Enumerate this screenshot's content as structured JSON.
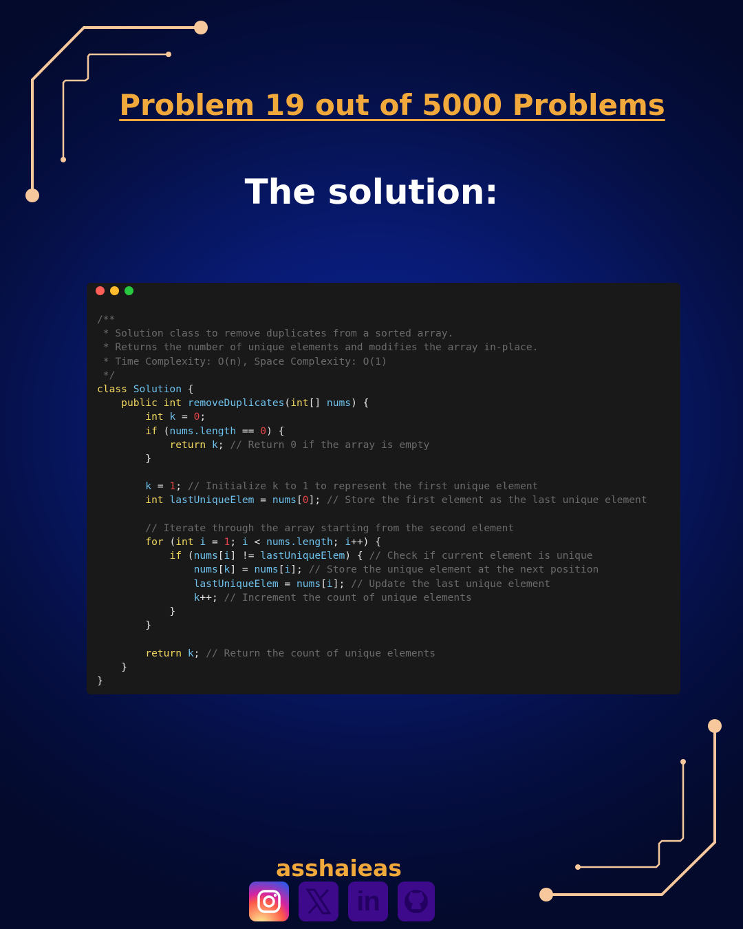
{
  "header": {
    "title": "Problem 19 out of 5000 Problems",
    "subtitle": "The solution:"
  },
  "colors": {
    "accent": "#f2a93b",
    "circuit": "#f7c89c",
    "code_bg": "#191919",
    "keyword": "#f0d860",
    "identifier": "#6ec1ec",
    "number": "#e5454a",
    "comment": "#6b6b6b",
    "plain": "#e6e6e6"
  },
  "window_dots": [
    {
      "name": "close-dot",
      "color": "#ff5f57"
    },
    {
      "name": "minimize-dot",
      "color": "#febc2e"
    },
    {
      "name": "maximize-dot",
      "color": "#28c840"
    }
  ],
  "code_lines": [
    [
      {
        "t": "/**",
        "c": "comment"
      }
    ],
    [
      {
        "t": " * Solution class to remove duplicates from a sorted array.",
        "c": "comment"
      }
    ],
    [
      {
        "t": " * Returns the number of unique elements and modifies the array in-place.",
        "c": "comment"
      }
    ],
    [
      {
        "t": " * Time Complexity: O(n), Space Complexity: O(1)",
        "c": "comment"
      }
    ],
    [
      {
        "t": " */",
        "c": "comment"
      }
    ],
    [
      {
        "t": "class ",
        "c": "keyword"
      },
      {
        "t": "Solution",
        "c": "identifier"
      },
      {
        "t": " {",
        "c": "plain"
      }
    ],
    [
      {
        "t": "    ",
        "c": "plain"
      },
      {
        "t": "public int ",
        "c": "keyword"
      },
      {
        "t": "removeDuplicates",
        "c": "identifier"
      },
      {
        "t": "(",
        "c": "plain"
      },
      {
        "t": "int",
        "c": "keyword"
      },
      {
        "t": "[] ",
        "c": "plain"
      },
      {
        "t": "nums",
        "c": "identifier"
      },
      {
        "t": ") {",
        "c": "plain"
      }
    ],
    [
      {
        "t": "        ",
        "c": "plain"
      },
      {
        "t": "int ",
        "c": "keyword"
      },
      {
        "t": "k",
        "c": "identifier"
      },
      {
        "t": " = ",
        "c": "plain"
      },
      {
        "t": "0",
        "c": "number"
      },
      {
        "t": ";",
        "c": "plain"
      }
    ],
    [
      {
        "t": "        ",
        "c": "plain"
      },
      {
        "t": "if",
        "c": "keyword"
      },
      {
        "t": " (",
        "c": "plain"
      },
      {
        "t": "nums.length",
        "c": "identifier"
      },
      {
        "t": " == ",
        "c": "plain"
      },
      {
        "t": "0",
        "c": "number"
      },
      {
        "t": ") {",
        "c": "plain"
      }
    ],
    [
      {
        "t": "            ",
        "c": "plain"
      },
      {
        "t": "return ",
        "c": "keyword"
      },
      {
        "t": "k",
        "c": "identifier"
      },
      {
        "t": "; ",
        "c": "plain"
      },
      {
        "t": "// Return 0 if the array is empty",
        "c": "comment"
      }
    ],
    [
      {
        "t": "        }",
        "c": "plain"
      }
    ],
    [
      {
        "t": "",
        "c": "plain"
      }
    ],
    [
      {
        "t": "        ",
        "c": "plain"
      },
      {
        "t": "k",
        "c": "identifier"
      },
      {
        "t": " = ",
        "c": "plain"
      },
      {
        "t": "1",
        "c": "number"
      },
      {
        "t": "; ",
        "c": "plain"
      },
      {
        "t": "// Initialize k to 1 to represent the first unique element",
        "c": "comment"
      }
    ],
    [
      {
        "t": "        ",
        "c": "plain"
      },
      {
        "t": "int ",
        "c": "keyword"
      },
      {
        "t": "lastUniqueElem",
        "c": "identifier"
      },
      {
        "t": " = ",
        "c": "plain"
      },
      {
        "t": "nums",
        "c": "identifier"
      },
      {
        "t": "[",
        "c": "plain"
      },
      {
        "t": "0",
        "c": "number"
      },
      {
        "t": "]; ",
        "c": "plain"
      },
      {
        "t": "// Store the first element as the last unique element",
        "c": "comment"
      }
    ],
    [
      {
        "t": "",
        "c": "plain"
      }
    ],
    [
      {
        "t": "        ",
        "c": "plain"
      },
      {
        "t": "// Iterate through the array starting from the second element",
        "c": "comment"
      }
    ],
    [
      {
        "t": "        ",
        "c": "plain"
      },
      {
        "t": "for",
        "c": "keyword"
      },
      {
        "t": " (",
        "c": "plain"
      },
      {
        "t": "int ",
        "c": "keyword"
      },
      {
        "t": "i",
        "c": "identifier"
      },
      {
        "t": " = ",
        "c": "plain"
      },
      {
        "t": "1",
        "c": "number"
      },
      {
        "t": "; ",
        "c": "plain"
      },
      {
        "t": "i",
        "c": "identifier"
      },
      {
        "t": " < ",
        "c": "plain"
      },
      {
        "t": "nums.length",
        "c": "identifier"
      },
      {
        "t": "; ",
        "c": "plain"
      },
      {
        "t": "i",
        "c": "identifier"
      },
      {
        "t": "++) {",
        "c": "plain"
      }
    ],
    [
      {
        "t": "            ",
        "c": "plain"
      },
      {
        "t": "if",
        "c": "keyword"
      },
      {
        "t": " (",
        "c": "plain"
      },
      {
        "t": "nums",
        "c": "identifier"
      },
      {
        "t": "[",
        "c": "plain"
      },
      {
        "t": "i",
        "c": "identifier"
      },
      {
        "t": "] != ",
        "c": "plain"
      },
      {
        "t": "lastUniqueElem",
        "c": "identifier"
      },
      {
        "t": ") { ",
        "c": "plain"
      },
      {
        "t": "// Check if current element is unique",
        "c": "comment"
      }
    ],
    [
      {
        "t": "                ",
        "c": "plain"
      },
      {
        "t": "nums",
        "c": "identifier"
      },
      {
        "t": "[",
        "c": "plain"
      },
      {
        "t": "k",
        "c": "identifier"
      },
      {
        "t": "] = ",
        "c": "plain"
      },
      {
        "t": "nums",
        "c": "identifier"
      },
      {
        "t": "[",
        "c": "plain"
      },
      {
        "t": "i",
        "c": "identifier"
      },
      {
        "t": "]; ",
        "c": "plain"
      },
      {
        "t": "// Store the unique element at the next position",
        "c": "comment"
      }
    ],
    [
      {
        "t": "                ",
        "c": "plain"
      },
      {
        "t": "lastUniqueElem",
        "c": "identifier"
      },
      {
        "t": " = ",
        "c": "plain"
      },
      {
        "t": "nums",
        "c": "identifier"
      },
      {
        "t": "[",
        "c": "plain"
      },
      {
        "t": "i",
        "c": "identifier"
      },
      {
        "t": "]; ",
        "c": "plain"
      },
      {
        "t": "// Update the last unique element",
        "c": "comment"
      }
    ],
    [
      {
        "t": "                ",
        "c": "plain"
      },
      {
        "t": "k",
        "c": "identifier"
      },
      {
        "t": "++; ",
        "c": "plain"
      },
      {
        "t": "// Increment the count of unique elements",
        "c": "comment"
      }
    ],
    [
      {
        "t": "            }",
        "c": "plain"
      }
    ],
    [
      {
        "t": "        }",
        "c": "plain"
      }
    ],
    [
      {
        "t": "",
        "c": "plain"
      }
    ],
    [
      {
        "t": "        ",
        "c": "plain"
      },
      {
        "t": "return ",
        "c": "keyword"
      },
      {
        "t": "k",
        "c": "identifier"
      },
      {
        "t": "; ",
        "c": "plain"
      },
      {
        "t": "// Return the count of unique elements",
        "c": "comment"
      }
    ],
    [
      {
        "t": "    }",
        "c": "plain"
      }
    ],
    [
      {
        "t": "}",
        "c": "plain"
      }
    ]
  ],
  "footer": {
    "handle": "asshaieas",
    "socials": [
      {
        "name": "instagram-icon"
      },
      {
        "name": "x-icon"
      },
      {
        "name": "linkedin-icon",
        "label": "in"
      },
      {
        "name": "github-icon"
      }
    ]
  }
}
